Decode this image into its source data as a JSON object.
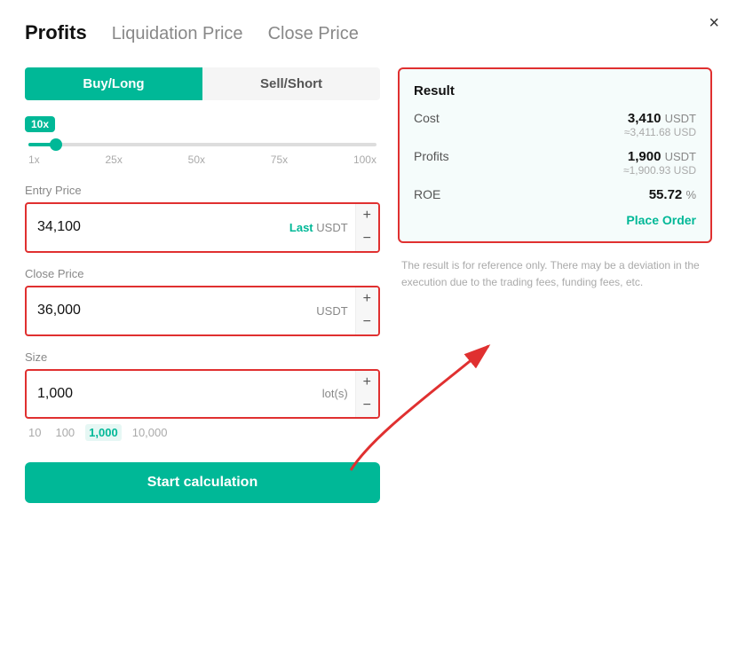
{
  "modal": {
    "close_label": "×"
  },
  "tabs": [
    {
      "id": "profits",
      "label": "Profits",
      "active": true
    },
    {
      "id": "liquidation-price",
      "label": "Liquidation Price",
      "active": false
    },
    {
      "id": "close-price",
      "label": "Close Price",
      "active": false
    }
  ],
  "toggle": {
    "buy_long_label": "Buy/Long",
    "sell_short_label": "Sell/Short"
  },
  "leverage": {
    "badge_label": "10x",
    "ticks": [
      "1x",
      "25x",
      "50x",
      "75x",
      "100x"
    ]
  },
  "entry_price": {
    "label": "Entry Price",
    "value": "34,100",
    "suffix_last": "Last",
    "suffix_unit": "USDT",
    "plus": "+",
    "minus": "−"
  },
  "close_price": {
    "label": "Close Price",
    "value": "36,000",
    "suffix_unit": "USDT",
    "plus": "+",
    "minus": "−"
  },
  "size": {
    "label": "Size",
    "value": "1,000",
    "suffix_unit": "lot(s)",
    "plus": "+",
    "minus": "−",
    "options": [
      {
        "label": "10",
        "active": false
      },
      {
        "label": "100",
        "active": false
      },
      {
        "label": "1,000",
        "active": true
      },
      {
        "label": "10,000",
        "active": false
      }
    ]
  },
  "start_button": {
    "label": "Start calculation"
  },
  "result": {
    "title": "Result",
    "rows": [
      {
        "key": "Cost",
        "value": "3,410",
        "unit": "USDT",
        "sub": "≈3,411.68 USD"
      },
      {
        "key": "Profits",
        "value": "1,900",
        "unit": "USDT",
        "sub": "≈1,900.93 USD"
      },
      {
        "key": "ROE",
        "value": "55.72",
        "unit": "%",
        "sub": ""
      }
    ],
    "place_order_label": "Place Order"
  },
  "disclaimer": "The result is for reference only. There may be a deviation in the execution due to the trading fees, funding fees, etc."
}
